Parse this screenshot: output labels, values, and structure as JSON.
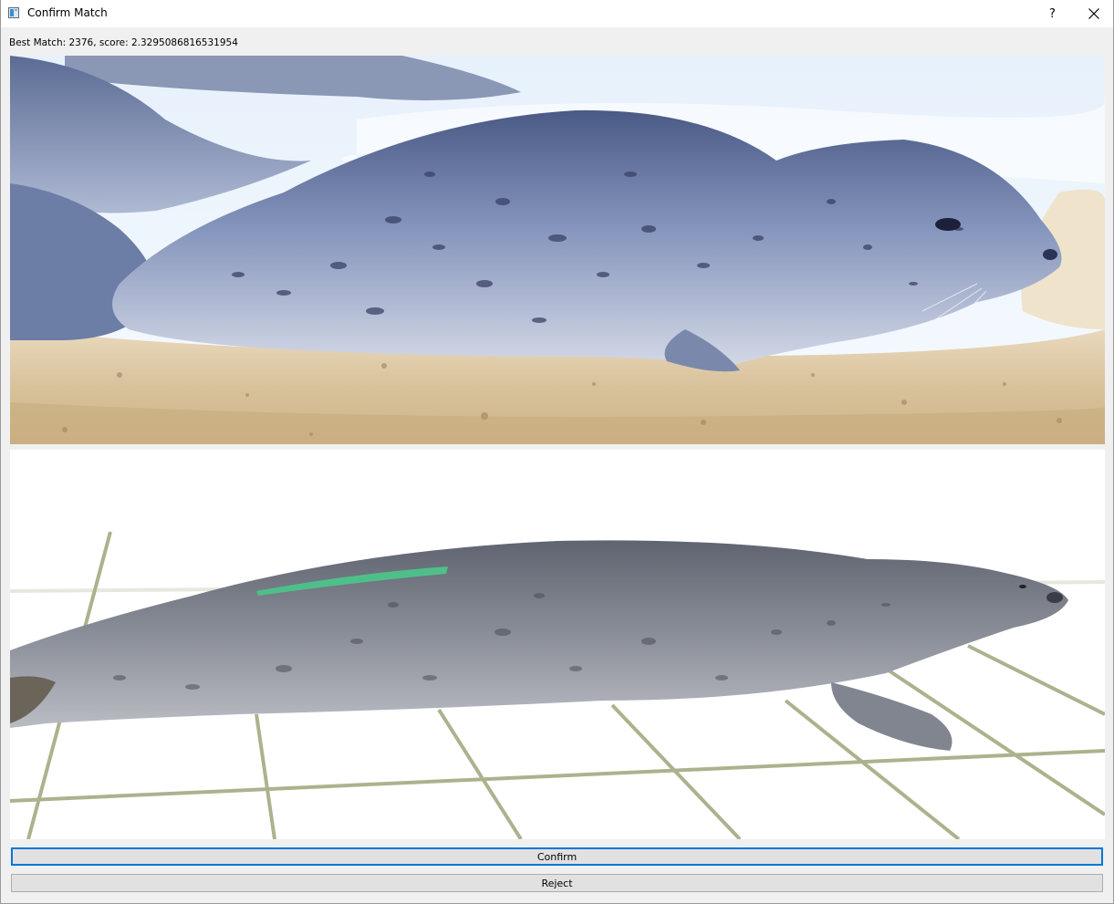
{
  "window": {
    "title": "Confirm Match",
    "help_symbol": "?"
  },
  "info": {
    "best_match_text": "Best Match: 2376, score: 2.3295086816531954"
  },
  "images": {
    "query_image": "seal-on-beach-photo",
    "match_image": "seal-on-tiles-photo"
  },
  "buttons": {
    "confirm_label": "Confirm",
    "reject_label": "Reject"
  },
  "colors": {
    "focus_accent": "#0078d7",
    "button_face": "#e1e1e1",
    "window_bg": "#f0f0f0"
  }
}
